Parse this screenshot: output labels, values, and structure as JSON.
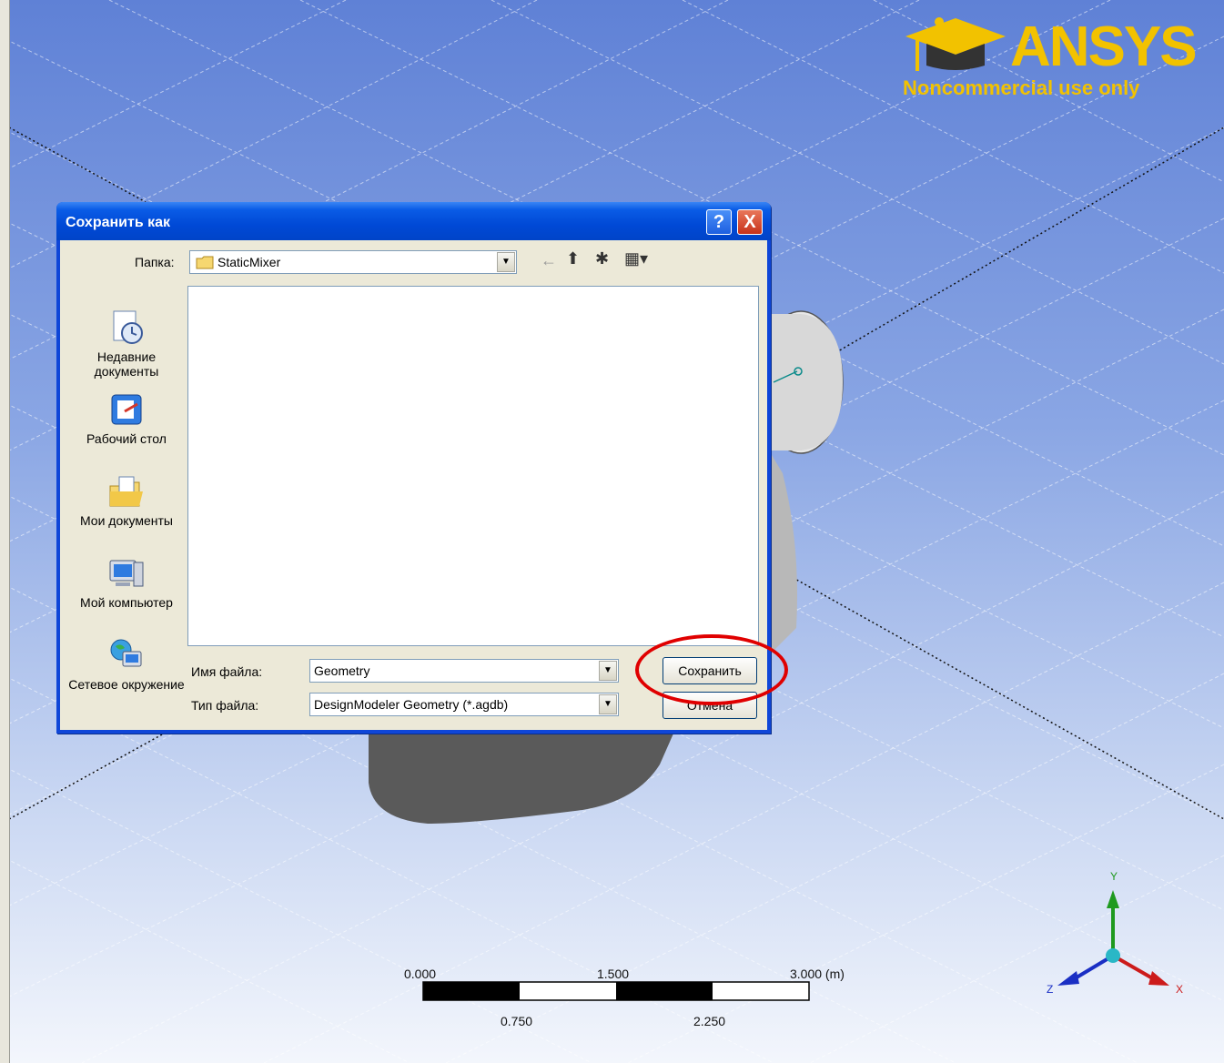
{
  "logo": {
    "brand": "ANSYS",
    "tagline": "Noncommercial use only"
  },
  "scale_bar": {
    "top_labels": [
      "0.000",
      "1.500",
      "3.000 (m)"
    ],
    "bottom_labels": [
      "0.750",
      "2.250"
    ]
  },
  "triad": {
    "x": "X",
    "y": "Y",
    "z": "Z"
  },
  "dialog": {
    "title": "Сохранить как",
    "help_button": "?",
    "close_button": "X",
    "folder_label": "Папка:",
    "folder_value": "StaticMixer",
    "places": [
      {
        "label": "Недавние документы",
        "icon": "recent-documents-icon"
      },
      {
        "label": "Рабочий стол",
        "icon": "desktop-icon"
      },
      {
        "label": "Мои документы",
        "icon": "my-documents-icon"
      },
      {
        "label": "Мой компьютер",
        "icon": "my-computer-icon"
      },
      {
        "label": "Сетевое окружение",
        "icon": "network-icon"
      }
    ],
    "filename_label": "Имя файла:",
    "filename_value": "Geometry",
    "filetype_label": "Тип файла:",
    "filetype_value": "DesignModeler Geometry (*.agdb)",
    "save_button": "Сохранить",
    "cancel_button": "Отмена"
  },
  "colors": {
    "highlight_circle": "#e00000",
    "titlebar": "#0049d6",
    "logo": "#f2c200"
  }
}
